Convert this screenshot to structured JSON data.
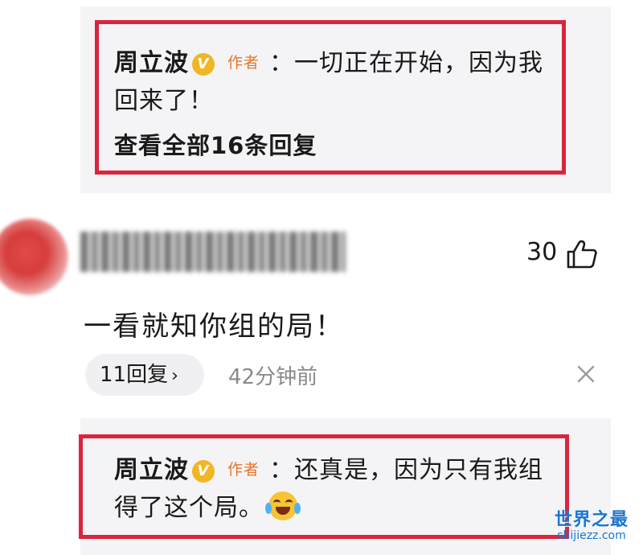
{
  "top_reply": {
    "author": "周立波",
    "verified_badge": "V",
    "author_tag": "作者",
    "text_line1": "：一切正在开始，因为我",
    "text_line2": "回来了！",
    "view_all": "查看全部16条回复"
  },
  "comment": {
    "like_count": "30",
    "text": "一看就知你组的局！",
    "reply_count_label": "11回复",
    "reply_chevron": "›",
    "time_ago": "42分钟前"
  },
  "bottom_reply": {
    "author": "周立波",
    "verified_badge": "V",
    "author_tag": "作者",
    "text_line1": "：还真是，因为只有我组",
    "text_line2": "得了这个局。",
    "emoji": "laugh-cry-emoji"
  },
  "watermark": {
    "main": "世界之最",
    "sub": "shijiezz.com"
  },
  "colors": {
    "highlight_frame": "#d9253d",
    "author_tag": "#e8742a",
    "badge": "#f2b623",
    "muted_text": "#8a8a8a",
    "watermark": "#1976d2"
  }
}
